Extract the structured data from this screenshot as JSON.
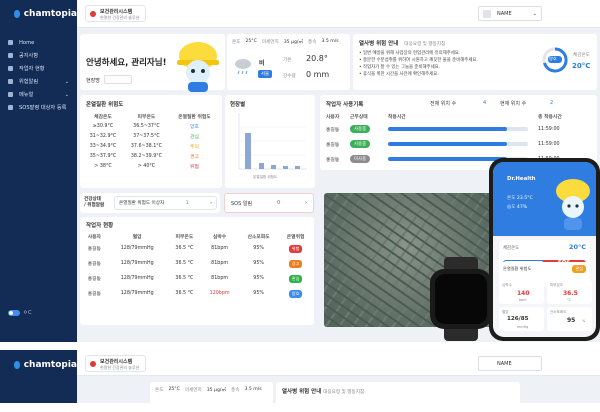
{
  "brand": {
    "name": "chamtopia"
  },
  "header": {
    "system_title": "보건관리시스템",
    "system_sub": "현명한 건강관리 솔루션",
    "user": "NAME"
  },
  "sidebar": {
    "items": [
      {
        "label": "Home"
      },
      {
        "label": "공지사항"
      },
      {
        "label": "작업자 현황"
      },
      {
        "label": "위험알림"
      },
      {
        "label": "메뉴얼"
      },
      {
        "label": "SOS발령 대상자 등록"
      }
    ],
    "toggle_label": "ㅇㄷ"
  },
  "greeting": {
    "text": "안녕하세요, 관리자님!",
    "site_label": "현장명"
  },
  "weather": {
    "temp_label": "온도",
    "temp": "25°C",
    "dust_label": "미세먼지",
    "dust": "35 μg/㎥",
    "wind_label": "풍속",
    "wind": "3.5 m/s",
    "condition": "비",
    "region": "서울",
    "temp_big_label": "기온",
    "temp_big": "20.8°",
    "rain_label": "강수량",
    "rain": "0 mm"
  },
  "heat": {
    "title": "열사병 위험 안내",
    "subtitle": "대응요령 및 행동지침",
    "bullets": [
      "일변 예방을 위해 사업장의 현업관리에 유의해주세요.",
      "충분한 수분섭취를 위하여 시원하고 깨끗한 물을 준비해주세요.",
      "작업자가 잘 수 있는 그늘을 준비해주세요.",
      "휴식을 위한 시간을 사전에 확인해주세요."
    ],
    "gauge_label": "양호",
    "feel_label": "체감온도",
    "feel": "20°C"
  },
  "risk": {
    "title": "온열질환 위험도",
    "headers": [
      "체감온도",
      "피부온도",
      "온열질환 위험도"
    ],
    "rows": [
      {
        "feel": "≥30.9°C",
        "skin": "36.5~37°C",
        "level": "양호",
        "color": "#3a8df0"
      },
      {
        "feel": "31~32.9°C",
        "skin": "37~37.5°C",
        "level": "관심",
        "color": "#2db34a"
      },
      {
        "feel": "33~34.9°C",
        "skin": "37.6~38.1°C",
        "level": "주의",
        "color": "#e0a800"
      },
      {
        "feel": "35~37.9°C",
        "skin": "38.2~39.9°C",
        "level": "경고",
        "color": "#f07b1d"
      },
      {
        "feel": "> 38°C",
        "skin": "> 40°C",
        "level": "위험",
        "color": "#e23b3b"
      }
    ]
  },
  "site_chart": {
    "title": "현장별",
    "xlabel": "온열질환 위험도"
  },
  "usage": {
    "title": "작업자 사용기록",
    "total_label": "전체 위치 수",
    "total": "4",
    "current_label": "현재 위치 수",
    "current": "2",
    "headers": [
      "사용자",
      "근무상태",
      "착용시간",
      "총 착용시간"
    ],
    "rows": [
      {
        "name": "홍길동",
        "status": "사용중",
        "fill": 0.85,
        "total": "11:59:00"
      },
      {
        "name": "홍길동",
        "status": "사용중",
        "fill": 0.85,
        "total": "11:59:00"
      },
      {
        "name": "홍길동",
        "status": "미사용",
        "fill": 0.85,
        "total": "11:59:00"
      }
    ]
  },
  "health_alert": {
    "label": "건강상태\n/ 위험알람",
    "item": "온열질환 위험도 이상자",
    "count": "1"
  },
  "sos": {
    "label": "SOS 알림",
    "count": "0"
  },
  "workers": {
    "title": "작업자 현황",
    "headers": [
      "사용자",
      "혈압",
      "피부온도",
      "심박수",
      "산소포화도",
      "온열위험"
    ],
    "rows": [
      {
        "name": "홍길동",
        "bp": "128/79mmHg",
        "skin": "36.5 °C",
        "hr": "81bpm",
        "spo2": "95%",
        "risk": "위험",
        "color": "#e23b3b",
        "hr_red": false
      },
      {
        "name": "홍길동",
        "bp": "128/79mmHg",
        "skin": "36.5 °C",
        "hr": "81bpm",
        "spo2": "95%",
        "risk": "경고",
        "color": "#f07b1d",
        "hr_red": false
      },
      {
        "name": "홍길동",
        "bp": "128/79mmHg",
        "skin": "36.5 °C",
        "hr": "81bpm",
        "spo2": "95%",
        "risk": "관심",
        "color": "#2db34a",
        "hr_red": false
      },
      {
        "name": "홍길동",
        "bp": "128/79mmHg",
        "skin": "36.5 °C",
        "hr": "120bpm",
        "spo2": "95%",
        "risk": "양호",
        "color": "#3a8df0",
        "hr_red": true
      }
    ]
  },
  "phone": {
    "app": "Dr.Health",
    "temp_label": "온도",
    "temp": "23.5°C",
    "hum_label": "습도",
    "hum": "47%",
    "feel_label": "체감온도",
    "feel": "20°C",
    "btn1": "온열질환에 대한\n응급처치법",
    "sos": "SOS",
    "sos_sub": "다급한 상황일 때 클릭하세요",
    "risk_label": "온열질환 위험도",
    "risk_val": "관심",
    "hr_label": "심박수",
    "hr": "140",
    "hr_unit": "bpm",
    "skin_label": "피부온도",
    "skin": "36.5",
    "skin_unit": "°C",
    "bp_label": "혈압",
    "bp": "126/85",
    "bp_unit": "mmHg",
    "spo2_label": "산소포화도",
    "spo2": "95",
    "spo2_unit": "%"
  },
  "colors": {
    "sidebar": "#132c55",
    "accent": "#2f7de0"
  }
}
